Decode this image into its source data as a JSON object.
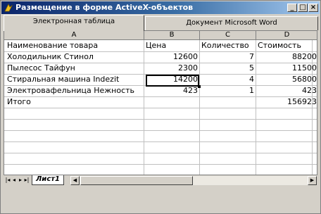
{
  "window": {
    "title": "Размещение в форме ActiveX-объектов",
    "minimize_label": "_",
    "maximize_label": "□",
    "close_label": "×"
  },
  "tabs": [
    {
      "label": "Электронная таблица",
      "active": true
    },
    {
      "label": "Документ Microsoft Word",
      "active": false
    }
  ],
  "sheet": {
    "columns": [
      "A",
      "B",
      "C",
      "D"
    ],
    "rows": [
      {
        "a": "Наименование товара",
        "b": "Цена",
        "c": "Количество",
        "d": "Стоимость"
      },
      {
        "a": "Холодильник Стинол",
        "b": "12600",
        "c": "7",
        "d": "88200"
      },
      {
        "a": "Пылесос Тайфун",
        "b": "2300",
        "c": "5",
        "d": "11500"
      },
      {
        "a": "Стиральная машина Indezit",
        "b": "14200",
        "c": "4",
        "d": "56800"
      },
      {
        "a": "Электровафельница Нежность",
        "b": "423",
        "c": "1",
        "d": "423"
      },
      {
        "a": "Итого",
        "b": "",
        "c": "",
        "d": "156923"
      }
    ],
    "selected_cell": "B4",
    "sheet_tab": "Лист1"
  },
  "colors": {
    "title_start": "#0a246a",
    "title_end": "#a6caf0",
    "chrome": "#d4d0c8"
  }
}
